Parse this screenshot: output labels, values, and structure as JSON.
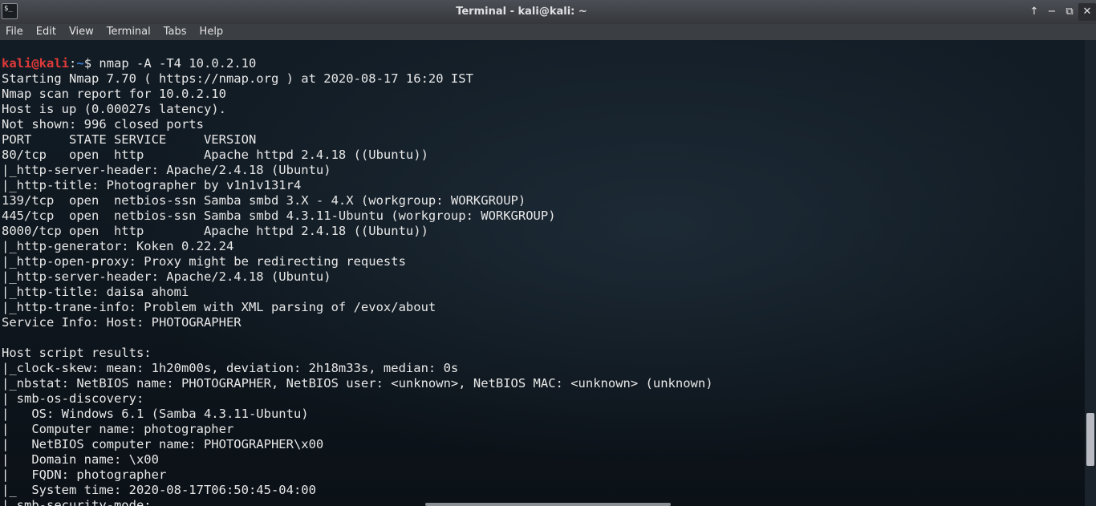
{
  "window": {
    "app_icon_text": "$_",
    "title": "Terminal - kali@kali: ~",
    "controls": {
      "up": "↑",
      "minimize": "−",
      "maximize": "⧉",
      "close": "✕"
    }
  },
  "menubar": {
    "items": [
      "File",
      "Edit",
      "View",
      "Terminal",
      "Tabs",
      "Help"
    ]
  },
  "terminal": {
    "prompt": {
      "user_host": "kali@kali",
      "separator": ":",
      "path": "~",
      "symbol": "$ ",
      "command": "nmap -A -T4 10.0.2.10"
    },
    "output_lines": [
      "Starting Nmap 7.70 ( https://nmap.org ) at 2020-08-17 16:20 IST",
      "Nmap scan report for 10.0.2.10",
      "Host is up (0.00027s latency).",
      "Not shown: 996 closed ports",
      "PORT     STATE SERVICE     VERSION",
      "80/tcp   open  http        Apache httpd 2.4.18 ((Ubuntu))",
      "|_http-server-header: Apache/2.4.18 (Ubuntu)",
      "|_http-title: Photographer by v1n1v131r4",
      "139/tcp  open  netbios-ssn Samba smbd 3.X - 4.X (workgroup: WORKGROUP)",
      "445/tcp  open  netbios-ssn Samba smbd 4.3.11-Ubuntu (workgroup: WORKGROUP)",
      "8000/tcp open  http        Apache httpd 2.4.18 ((Ubuntu))",
      "|_http-generator: Koken 0.22.24",
      "|_http-open-proxy: Proxy might be redirecting requests",
      "|_http-server-header: Apache/2.4.18 (Ubuntu)",
      "|_http-title: daisa ahomi",
      "|_http-trane-info: Problem with XML parsing of /evox/about",
      "Service Info: Host: PHOTOGRAPHER",
      "",
      "Host script results:",
      "|_clock-skew: mean: 1h20m00s, deviation: 2h18m33s, median: 0s",
      "|_nbstat: NetBIOS name: PHOTOGRAPHER, NetBIOS user: <unknown>, NetBIOS MAC: <unknown> (unknown)",
      "| smb-os-discovery: ",
      "|   OS: Windows 6.1 (Samba 4.3.11-Ubuntu)",
      "|   Computer name: photographer",
      "|   NetBIOS computer name: PHOTOGRAPHER\\x00",
      "|   Domain name: \\x00",
      "|   FQDN: photographer",
      "|_  System time: 2020-08-17T06:50:45-04:00",
      "| smb-security-mode: "
    ]
  }
}
